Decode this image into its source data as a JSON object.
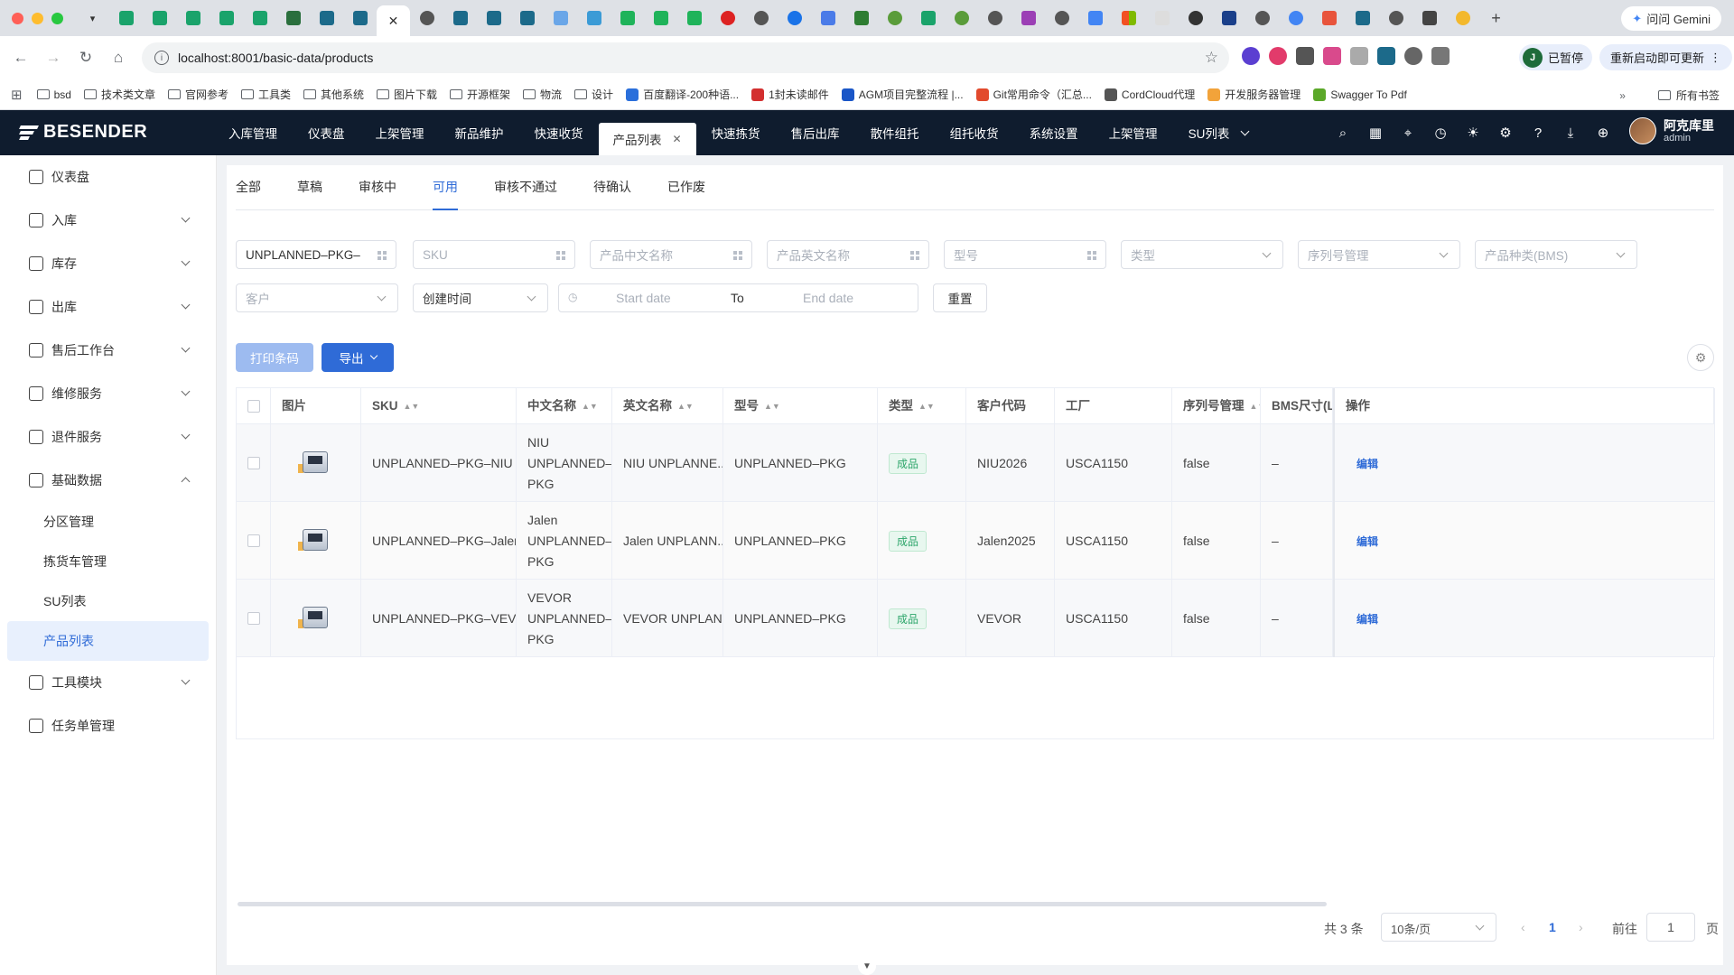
{
  "browser": {
    "url": "localhost:8001/basic-data/products",
    "gemini_label": "问问 Gemini",
    "profile_initial": "J",
    "paused_label": "已暂停",
    "relaunch_label": "重新启动即可更新",
    "bookmarks": [
      "bsd",
      "技术类文章",
      "官网参考",
      "工具类",
      "其他系统",
      "图片下载",
      "开源框架",
      "物流",
      "设计",
      "百度翻译-200种语...",
      "1封未读邮件",
      "AGM项目完整流程 |...",
      "Git常用命令（汇总...",
      "CordCloud代理",
      "开发服务器管理",
      "Swagger To Pdf"
    ],
    "all_bookmarks_label": "所有书签"
  },
  "app": {
    "brand": "BESENDER",
    "nav": [
      "入库管理",
      "仪表盘",
      "上架管理",
      "新品维护",
      "快速收货",
      "产品列表",
      "快速拣货",
      "售后出库",
      "散件组托",
      "组托收货",
      "系统设置",
      "上架管理",
      "SU列表"
    ],
    "user_name": "阿克库里",
    "user_role": "admin"
  },
  "sidebar": {
    "items": [
      {
        "label": "仪表盘",
        "icon": "home-icon"
      },
      {
        "label": "入库",
        "icon": "inbound-icon"
      },
      {
        "label": "库存",
        "icon": "inventory-icon"
      },
      {
        "label": "出库",
        "icon": "outbound-icon"
      },
      {
        "label": "售后工作台",
        "icon": "aftersale-icon"
      },
      {
        "label": "维修服务",
        "icon": "wrench-icon"
      },
      {
        "label": "退件服务",
        "icon": "return-icon"
      },
      {
        "label": "基础数据",
        "icon": "basic-data-icon"
      }
    ],
    "sub_items": [
      "分区管理",
      "拣货车管理",
      "SU列表",
      "产品列表"
    ],
    "tail_items": [
      {
        "label": "工具模块",
        "icon": "tools-icon"
      },
      {
        "label": "任务单管理",
        "icon": "task-icon"
      }
    ]
  },
  "tabs": [
    "全部",
    "草稿",
    "审核中",
    "可用",
    "审核不通过",
    "待确认",
    "已作废"
  ],
  "filters": {
    "sku_filter_value": "UNPLANNED–PKG–",
    "sku": "SKU",
    "cn_name": "产品中文名称",
    "en_name": "产品英文名称",
    "model": "型号",
    "type": "类型",
    "serial": "序列号管理",
    "bms_category": "产品种类(BMS)",
    "customer": "客户",
    "created_time": "创建时间",
    "start_date": "Start date",
    "to": "To",
    "end_date": "End date",
    "reset": "重置"
  },
  "actions": {
    "print_barcode": "打印条码",
    "export": "导出"
  },
  "table": {
    "headers": [
      "图片",
      "SKU",
      "中文名称",
      "英文名称",
      "型号",
      "类型",
      "客户代码",
      "工厂",
      "序列号管理",
      "BMS尺寸(L*W",
      "操作"
    ],
    "rows": [
      {
        "sku": "UNPLANNED–PKG–NIU",
        "cn": "NIU UNPLANNED–PKG",
        "en": "NIU UNPLANNE...",
        "model": "UNPLANNED–PKG",
        "type": "成品",
        "customer": "NIU2026",
        "factory": "USCA1150",
        "serial": "false",
        "bms": "–",
        "action": "编辑"
      },
      {
        "sku": "UNPLANNED–PKG–Jalen",
        "cn": "Jalen UNPLANNED–PKG",
        "en": "Jalen UNPLANN...",
        "model": "UNPLANNED–PKG",
        "type": "成品",
        "customer": "Jalen2025",
        "factory": "USCA1150",
        "serial": "false",
        "bms": "–",
        "action": "编辑"
      },
      {
        "sku": "UNPLANNED–PKG–VEVOR",
        "cn": "VEVOR UNPLANNED–PKG",
        "en": "VEVOR UNPLAN...",
        "model": "UNPLANNED–PKG",
        "type": "成品",
        "customer": "VEVOR",
        "factory": "USCA1150",
        "serial": "false",
        "bms": "–",
        "action": "编辑"
      }
    ]
  },
  "pagination": {
    "total": "共 3 条",
    "page_size": "10条/页",
    "current": "1",
    "goto_label": "前往",
    "goto_value": "1",
    "page_suffix": "页"
  }
}
